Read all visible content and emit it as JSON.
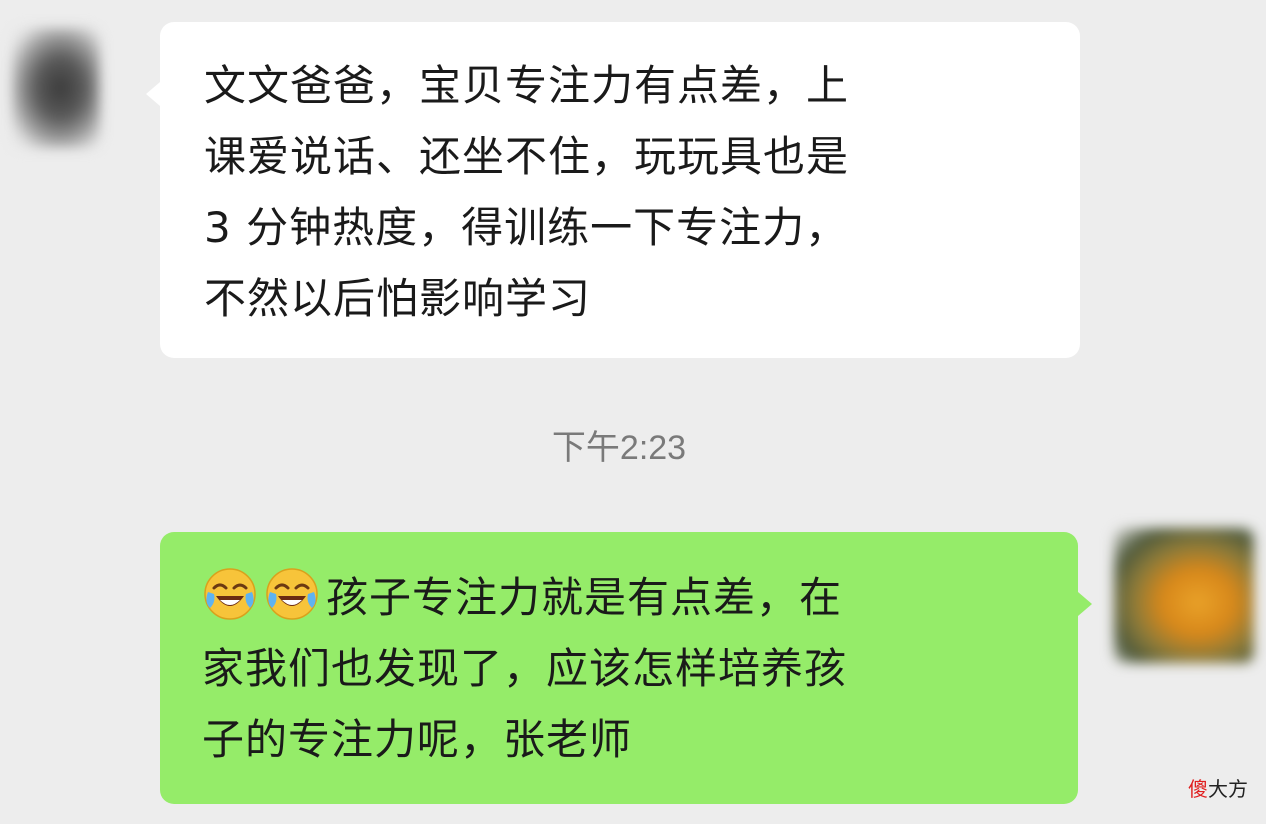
{
  "incoming_message": {
    "lines": [
      "文文爸爸，宝贝专注力有点差，上",
      "课爱说话、还坐不住，玩玩具也是",
      "3 分钟热度，得训练一下专注力，",
      "不然以后怕影响学习"
    ]
  },
  "timestamp": "下午2:23",
  "outgoing_message": {
    "emojis": [
      "crying-laughing-emoji",
      "crying-laughing-emoji"
    ],
    "lines": [
      "孩子专注力就是有点差，在",
      "家我们也发现了，应该怎样培养孩",
      "子的专注力呢，张老师"
    ]
  },
  "watermark": {
    "red": "傻",
    "rest": "大方"
  },
  "colors": {
    "background": "#ededed",
    "incoming_bubble": "#ffffff",
    "outgoing_bubble": "#95ec69",
    "timestamp_text": "#7a7a7a"
  }
}
